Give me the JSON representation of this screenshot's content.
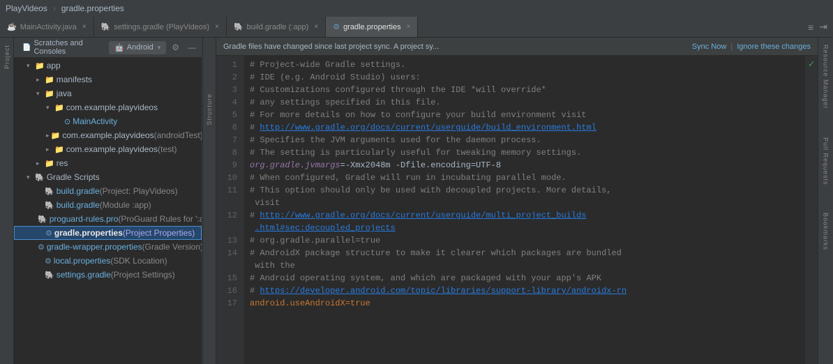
{
  "titleBar": {
    "appName": "PlayVideos",
    "fileName": "gradle.properties"
  },
  "tabs": [
    {
      "id": "main-activity",
      "label": "MainActivity.java",
      "icon": "java",
      "active": false
    },
    {
      "id": "settings-gradle",
      "label": "settings.gradle (PlayVideos)",
      "icon": "gradle",
      "active": false
    },
    {
      "id": "build-gradle",
      "label": "build.gradle (:app)",
      "icon": "gradle",
      "active": false
    },
    {
      "id": "gradle-properties",
      "label": "gradle.properties",
      "icon": "props",
      "active": true
    }
  ],
  "leftPanel": {
    "scratchesTab": "Scratches and Consoles",
    "androidTab": "Android"
  },
  "fileTree": {
    "items": [
      {
        "id": "app",
        "label": "app",
        "indent": 1,
        "type": "folder",
        "arrow": "open"
      },
      {
        "id": "manifests",
        "label": "manifests",
        "indent": 2,
        "type": "folder",
        "arrow": "closed"
      },
      {
        "id": "java",
        "label": "java",
        "indent": 2,
        "type": "folder",
        "arrow": "open"
      },
      {
        "id": "com-example",
        "label": "com.example.playvideos",
        "indent": 3,
        "type": "folder",
        "arrow": "open"
      },
      {
        "id": "main-activity",
        "label": "MainActivity",
        "indent": 4,
        "type": "activity",
        "arrow": "empty"
      },
      {
        "id": "com-example-test",
        "label": "com.example.playvideos (androidTest)",
        "indent": 3,
        "type": "folder",
        "arrow": "closed"
      },
      {
        "id": "com-example-unit",
        "label": "com.example.playvideos (test)",
        "indent": 3,
        "type": "folder",
        "arrow": "closed"
      },
      {
        "id": "res",
        "label": "res",
        "indent": 2,
        "type": "folder",
        "arrow": "closed"
      },
      {
        "id": "gradle-scripts",
        "label": "Gradle Scripts",
        "indent": 1,
        "type": "folder-gradle",
        "arrow": "open"
      },
      {
        "id": "build-gradle-project",
        "label": "build.gradle (Project: PlayVideos)",
        "indent": 2,
        "type": "gradle",
        "arrow": "empty"
      },
      {
        "id": "build-gradle-module",
        "label": "build.gradle (Module :app)",
        "indent": 2,
        "type": "gradle",
        "arrow": "empty"
      },
      {
        "id": "proguard",
        "label": "proguard-rules.pro (ProGuard Rules for ':app')",
        "indent": 2,
        "type": "gradle",
        "arrow": "empty"
      },
      {
        "id": "gradle-props",
        "label": "gradle.properties (Project Properties)",
        "indent": 2,
        "type": "props",
        "arrow": "empty",
        "selected": true
      },
      {
        "id": "gradle-wrapper",
        "label": "gradle-wrapper.properties (Gradle Version)",
        "indent": 2,
        "type": "props",
        "arrow": "empty"
      },
      {
        "id": "local-props",
        "label": "local.properties (SDK Location)",
        "indent": 2,
        "type": "props",
        "arrow": "empty"
      },
      {
        "id": "settings-gradle-file",
        "label": "settings.gradle (Project Settings)",
        "indent": 2,
        "type": "gradle",
        "arrow": "empty"
      }
    ]
  },
  "notification": {
    "text": "Gradle files have changed since last project sync. A project sy...",
    "syncLink": "Sync Now",
    "dismissLink": "Ignore these changes"
  },
  "codeLines": [
    {
      "num": 1,
      "content": "# Project-wide Gradle settings.",
      "type": "comment"
    },
    {
      "num": 2,
      "content": "# IDE (e.g. Android Studio) users:",
      "type": "comment"
    },
    {
      "num": 3,
      "content": "# Customizations configured through the IDE *will override*",
      "type": "comment"
    },
    {
      "num": 4,
      "content": "# any settings specified in this file.",
      "type": "comment"
    },
    {
      "num": 5,
      "content": "# For more details on how to configure your build environment visit",
      "type": "comment"
    },
    {
      "num": 6,
      "content": "# http://www.gradle.org/docs/current/userguide/build_environment.html",
      "type": "comment-link"
    },
    {
      "num": 7,
      "content": "# Specifies the JVM arguments used for the daemon process.",
      "type": "comment"
    },
    {
      "num": 8,
      "content": "# The setting is particularly useful for tweaking memory settings.",
      "type": "comment"
    },
    {
      "num": 9,
      "content": "org.gradle.jvmargs=-Xmx2048m -Dfile.encoding=UTF-8",
      "type": "keyvalue"
    },
    {
      "num": 10,
      "content": "# When configured, Gradle will run in incubating parallel mode.",
      "type": "comment"
    },
    {
      "num": 11,
      "content": "# This option should only be used with decoupled projects. More details,",
      "type": "comment"
    },
    {
      "num": 11,
      "content": " visit",
      "type": "comment-cont"
    },
    {
      "num": 12,
      "content": "# http://www.gradle.org/docs/current/userguide/multi_project_builds",
      "type": "comment-link"
    },
    {
      "num": 12,
      "content": " .html#sec:decoupled_projects",
      "type": "comment-link-cont"
    },
    {
      "num": 13,
      "content": "# org.gradle.parallel=true",
      "type": "comment"
    },
    {
      "num": 14,
      "content": "# AndroidX package structure to make it clearer which packages are bundled",
      "type": "comment"
    },
    {
      "num": 14,
      "content": " with the",
      "type": "comment-cont"
    },
    {
      "num": 15,
      "content": "# Android operating system, and which are packaged with your app's APK",
      "type": "comment"
    },
    {
      "num": 16,
      "content": "# https://developer.android.com/topic/libraries/support-library/androidx-rn",
      "type": "comment-link"
    },
    {
      "num": 17,
      "content": "android.useAndroidX=true",
      "type": "orange"
    }
  ],
  "sideStrips": {
    "project": "Project",
    "structure": "Structure",
    "resourceManager": "Resource Manager",
    "pullRequests": "Pull Requests",
    "bookmarks": "Bookmarks"
  }
}
